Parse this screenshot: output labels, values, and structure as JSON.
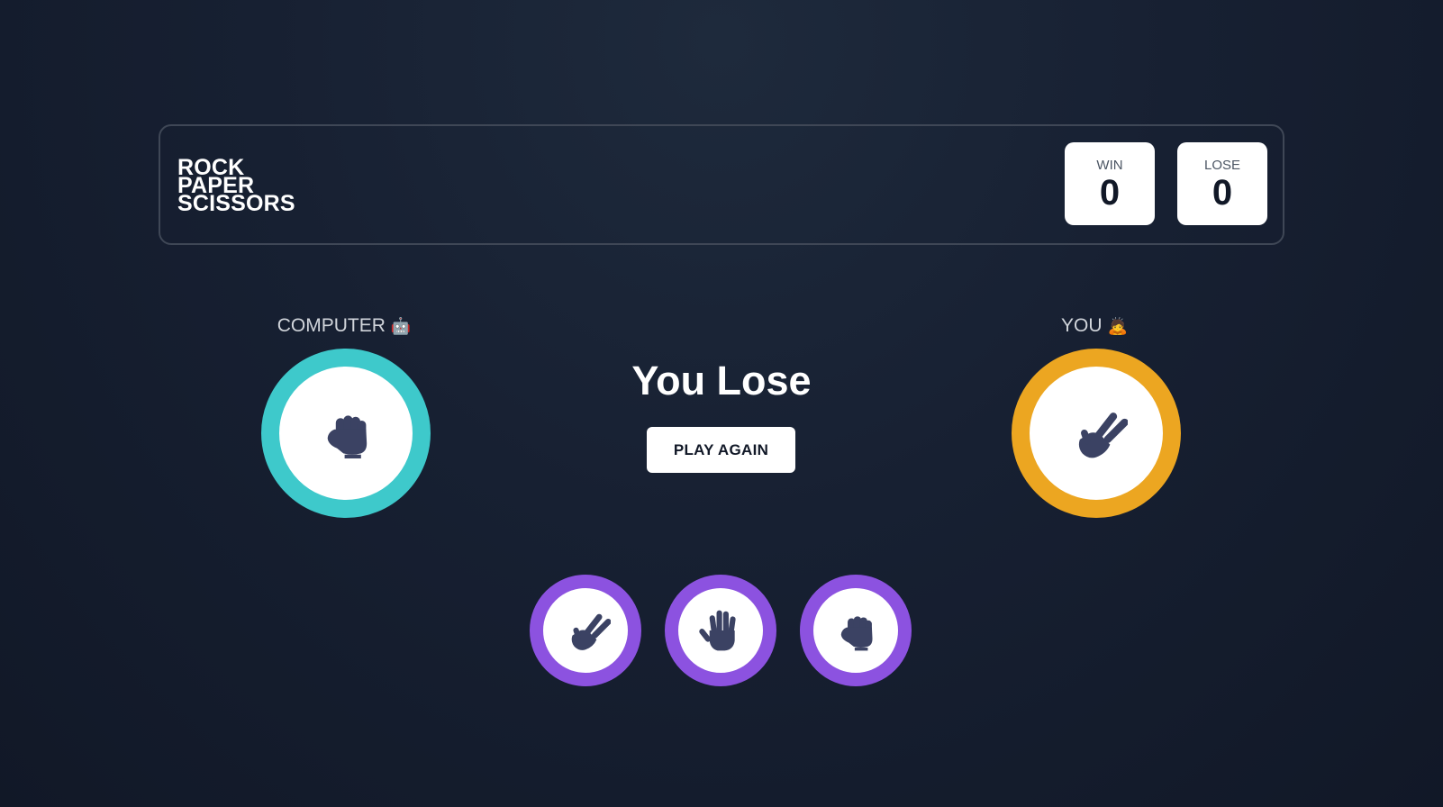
{
  "header": {
    "title_lines": [
      "ROCK",
      "PAPER",
      "SCISSORS"
    ],
    "scores": [
      {
        "label": "WIN",
        "value": "0"
      },
      {
        "label": "LOSE",
        "value": "0"
      }
    ]
  },
  "players": {
    "computer": {
      "label": "COMPUTER",
      "emoji": "🤖",
      "choice_icon": "rock-icon",
      "ring_color": "#3ec9cb"
    },
    "you": {
      "label": "YOU",
      "emoji": "🙇",
      "choice_icon": "scissors-icon",
      "ring_color": "#eca621"
    }
  },
  "result": {
    "text": "You Lose",
    "play_again_label": "PLAY AGAIN"
  },
  "choices": [
    {
      "icon": "scissors-icon"
    },
    {
      "icon": "paper-icon"
    },
    {
      "icon": "rock-icon"
    }
  ],
  "colors": {
    "choice_ring": "#8c52e0",
    "icon_fill": "#3b4263",
    "background": "#172032"
  }
}
